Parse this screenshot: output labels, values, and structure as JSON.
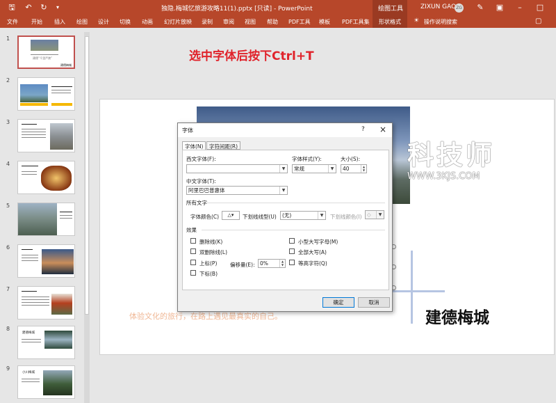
{
  "titlebar": {
    "title": "独隐.梅城忆旅游攻略11(1).pptx [只读] - PowerPoint",
    "context_group": "绘图工具",
    "user_name": "ZIXUN GAO",
    "avatar_initials": "ZG"
  },
  "ribbon": {
    "tabs": [
      "文件",
      "开始",
      "插入",
      "绘图",
      "设计",
      "切换",
      "动画",
      "幻灯片放映",
      "录制",
      "审阅",
      "视图",
      "帮助",
      "PDF工具",
      "模板",
      "PDF工具集",
      "形状格式"
    ],
    "tell_me": "操作说明搜索"
  },
  "thumbnails": {
    "numbers": [
      "1",
      "2",
      "3",
      "4",
      "5",
      "6",
      "7",
      "8",
      "9"
    ],
    "slide1_caption": "建德“千里严陵”",
    "slide1_tag": "建德梅城",
    "slide8_title": "建德梅城",
    "slide9_title": "小川梅城"
  },
  "slide": {
    "hint": "选中字体后按下Ctrl+T",
    "city_title": "建德梅城",
    "subtitle": "体验文化的旅行，在路上遇见最真实的自己。"
  },
  "watermark": {
    "text": "科技师",
    "url": "WWW.3KJS.COM"
  },
  "dialog": {
    "title": "字体",
    "help": "?",
    "close": "×",
    "tabs": [
      "字体(N)",
      "字符间距(R)"
    ],
    "western_font_label": "西文字体(F):",
    "western_font_value": "",
    "style_label": "字体样式(Y):",
    "style_value": "常规",
    "size_label": "大小(S):",
    "size_value": "40",
    "chinese_font_label": "中文字体(T):",
    "chinese_font_value": "阿里巴巴普惠体",
    "all_text_label": "所有文字",
    "font_color_label": "字体颜色(C)",
    "underline_style_label": "下划线线型(U)",
    "underline_style_value": "(无)",
    "underline_color_label": "下划线颜色(I)",
    "effects_label": "效果",
    "effects_left": [
      "删除线(K)",
      "双删除线(L)",
      "上标(P)",
      "下标(B)"
    ],
    "effects_right": [
      "小型大写字母(M)",
      "全部大写(A)",
      "等高字符(Q)"
    ],
    "offset_label": "偏移量(E):",
    "offset_value": "0%",
    "ok": "确定",
    "cancel": "取消"
  }
}
